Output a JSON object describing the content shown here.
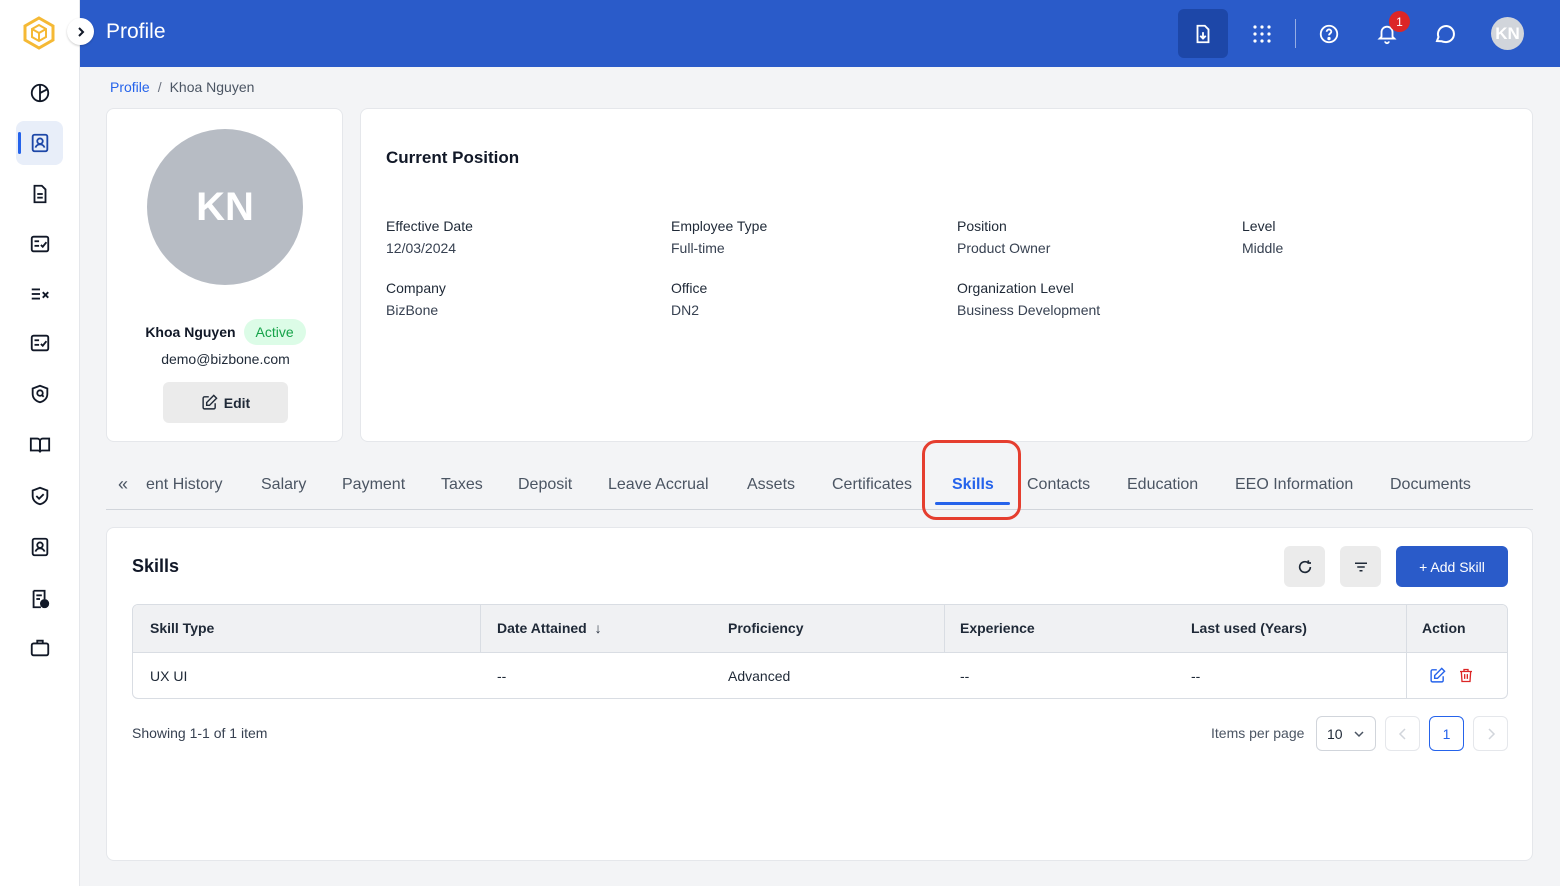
{
  "header": {
    "title": "Profile",
    "notification_count": "1",
    "avatar_initials": "KN"
  },
  "breadcrumb": {
    "root": "Profile",
    "separator": "/",
    "current": "Khoa Nguyen"
  },
  "profile": {
    "initials": "KN",
    "name": "Khoa Nguyen",
    "status": "Active",
    "email": "demo@bizbone.com",
    "edit_label": "Edit"
  },
  "position": {
    "title": "Current Position",
    "fields": [
      {
        "label": "Effective Date",
        "value": "12/03/2024"
      },
      {
        "label": "Employee Type",
        "value": "Full-time"
      },
      {
        "label": "Position",
        "value": "Product Owner"
      },
      {
        "label": "Level",
        "value": "Middle"
      },
      {
        "label": "Company",
        "value": "BizBone"
      },
      {
        "label": "Office",
        "value": "DN2"
      },
      {
        "label": "Organization Level",
        "value": "Business Development"
      }
    ]
  },
  "tabs": {
    "prev_icon": "«",
    "items": [
      "ent History",
      "Salary",
      "Payment",
      "Taxes",
      "Deposit",
      "Leave Accrual",
      "Assets",
      "Certificates",
      "Skills",
      "Contacts",
      "Education",
      "EEO Information",
      "Documents"
    ],
    "active": "Skills"
  },
  "skills": {
    "title": "Skills",
    "add_label": "+ Add Skill",
    "columns": [
      "Skill Type",
      "Date Attained",
      "Proficiency",
      "Experience",
      "Last used (Years)",
      "Action"
    ],
    "sort_icon": "↓",
    "rows": [
      {
        "skill_type": "UX UI",
        "date_attained": "--",
        "proficiency": "Advanced",
        "experience": "--",
        "last_used": "--"
      }
    ],
    "showing": "Showing 1-1 of 1 item",
    "items_per_page_label": "Items per page",
    "items_per_page": "10",
    "current_page": "1"
  },
  "colors": {
    "primary": "#2a5bc9",
    "accent": "#2563eb",
    "success": "#16a34a",
    "danger": "#dc2626",
    "highlight": "#e53e2f"
  },
  "icons": {
    "sidebar": [
      "chart-pie-icon",
      "profile-card-icon",
      "document-icon",
      "checklist-icon",
      "task-list-icon",
      "checkbox-list-icon",
      "shield-search-icon",
      "book-icon",
      "shield-check-icon",
      "contact-card-icon",
      "document-check-icon",
      "briefcase-icon"
    ],
    "header": [
      "download-icon",
      "apps-grid-icon",
      "help-icon",
      "bell-icon",
      "chat-icon"
    ]
  }
}
